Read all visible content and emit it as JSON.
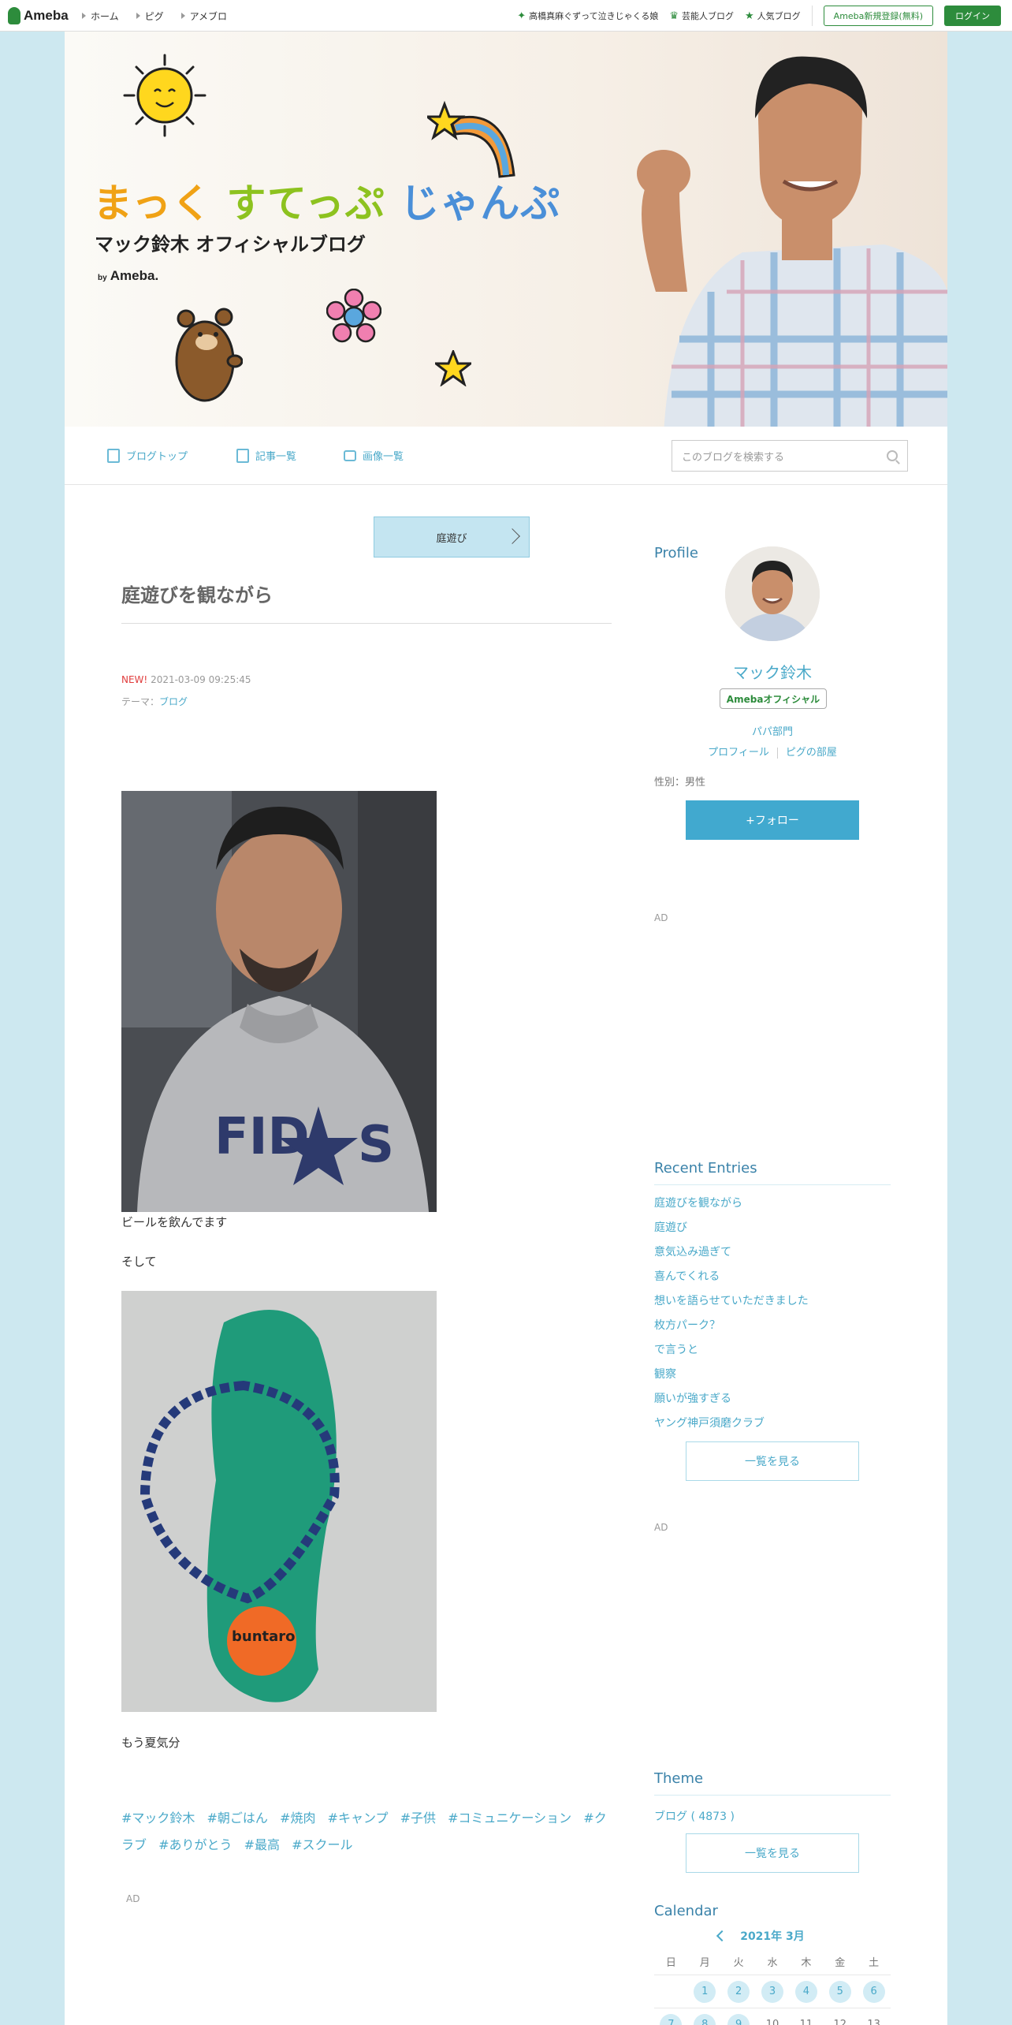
{
  "topbar": {
    "logo": "Ameba",
    "nav": [
      "ホーム",
      "ピグ",
      "アメブロ"
    ],
    "links": [
      "高橋真麻ぐずって泣きじゃくる娘",
      "芸能人ブログ",
      "人気ブログ"
    ],
    "register": "Ameba新規登録(無料)",
    "login": "ログイン"
  },
  "banner": {
    "title_a": "まっく",
    "title_b": "すてっぷ",
    "title_c": "じゃんぷ",
    "subtitle": "マック鈴木 オフィシャルブログ",
    "by": "by",
    "by_brand": "Ameba."
  },
  "blognav": {
    "items": [
      "ブログトップ",
      "記事一覧",
      "画像一覧"
    ],
    "search_placeholder": "このブログを検索する"
  },
  "entry": {
    "theme_button": "庭遊び",
    "title": "庭遊びを観ながら",
    "new_label": "NEW!",
    "date": "2021-03-09 09:25:45",
    "theme_prefix": "テーマ：",
    "theme_link": "ブログ",
    "caption1": "ビールを飲んでます",
    "para2": "そして",
    "para3": "もう夏気分",
    "hashtags": [
      "#マック鈴木",
      "#朝ごはん",
      "#焼肉",
      "#キャンプ",
      "#子供",
      "#コミュニケーション",
      "#クラブ",
      "#ありがとう",
      "#最高",
      "#スクール"
    ],
    "ad": "AD"
  },
  "sidebar": {
    "profile_heading": "Profile",
    "name": "マック鈴木",
    "badge": "Amebaオフィシャル",
    "category": "パパ部門",
    "links": [
      "プロフィール",
      "ピグの部屋"
    ],
    "gender": "性別：男性",
    "follow": "+フォロー",
    "ad": "AD",
    "recent_heading": "Recent Entries",
    "recent": [
      "庭遊びを観ながら",
      "庭遊び",
      "意気込み過ぎて",
      "喜んでくれる",
      "想いを語らせていただきました",
      "枚方パーク？",
      "で言うと",
      "観察",
      "願いが強すぎる",
      "ヤング神戸須磨クラブ"
    ],
    "see_all": "一覧を見る",
    "theme_heading": "Theme",
    "theme_entry": "ブログ ( 4873 )",
    "calendar_heading": "Calendar",
    "calendar_month": "2021年 3月",
    "weekdays": [
      "日",
      "月",
      "火",
      "水",
      "木",
      "金",
      "土"
    ],
    "week1": [
      "",
      "1",
      "2",
      "3",
      "4",
      "5",
      "6"
    ],
    "week2": [
      "7",
      "8",
      "9",
      "10",
      "11",
      "12",
      "13"
    ]
  }
}
